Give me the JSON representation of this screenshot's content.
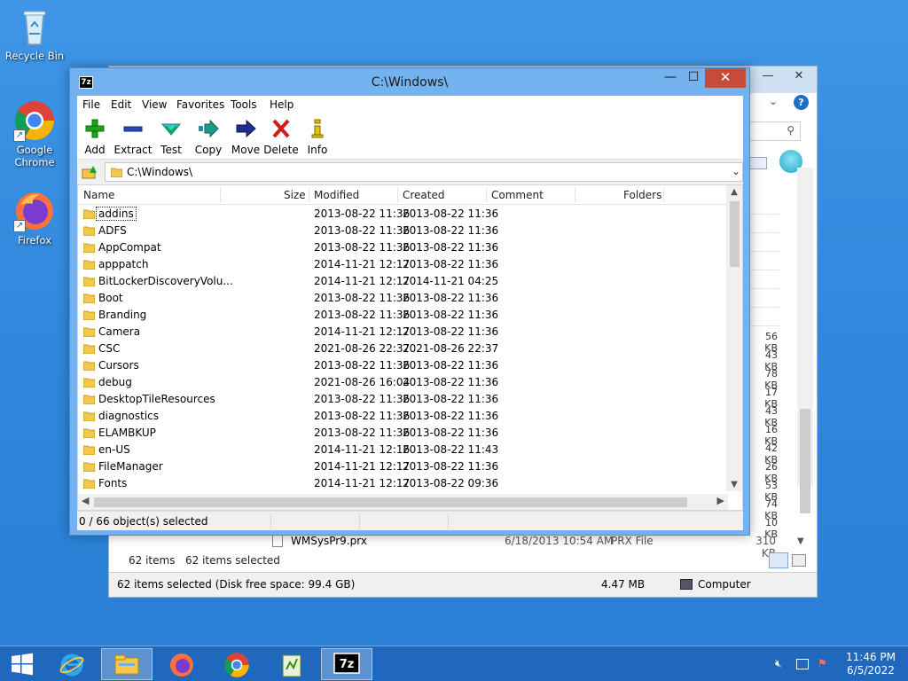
{
  "desktop": {
    "icons": [
      {
        "label": "Recycle Bin",
        "icon": "recycle-bin-icon"
      },
      {
        "label": "Google Chrome",
        "icon": "chrome-icon"
      },
      {
        "label": "Firefox",
        "icon": "firefox-icon"
      }
    ]
  },
  "background_window": {
    "sizes": [
      "56 KB",
      "43 KB",
      "78 KB",
      "17 KB",
      "43 KB",
      "16 KB",
      "42 KB",
      "26 KB",
      "53 KB",
      "74 KB",
      "10 KB"
    ],
    "last_row": {
      "name": "WMSysPr9.prx",
      "date": "6/18/2013 10:54 AM",
      "type": "PRX File",
      "size": "310 KB"
    },
    "items_count": "62 items",
    "items_selected": "62 items selected",
    "status_left": "62 items selected (Disk free space: 99.4 GB)",
    "status_size": "4.47 MB",
    "status_location": "Computer"
  },
  "sevenzip": {
    "title": "C:\\Windows\\",
    "app_icon_label": "7z",
    "menu": [
      "File",
      "Edit",
      "View",
      "Favorites",
      "Tools",
      "Help"
    ],
    "toolbar": [
      {
        "label": "Add",
        "icon": "add-icon"
      },
      {
        "label": "Extract",
        "icon": "extract-icon"
      },
      {
        "label": "Test",
        "icon": "test-icon"
      },
      {
        "label": "Copy",
        "icon": "copy-icon"
      },
      {
        "label": "Move",
        "icon": "move-icon"
      },
      {
        "label": "Delete",
        "icon": "delete-icon"
      },
      {
        "label": "Info",
        "icon": "info-icon"
      }
    ],
    "address": "C:\\Windows\\",
    "columns": {
      "name": "Name",
      "size": "Size",
      "modified": "Modified",
      "created": "Created",
      "comment": "Comment",
      "folders": "Folders"
    },
    "rows": [
      {
        "name": "addins",
        "modified": "2013-08-22 11:36",
        "created": "2013-08-22 11:36"
      },
      {
        "name": "ADFS",
        "modified": "2013-08-22 11:36",
        "created": "2013-08-22 11:36"
      },
      {
        "name": "AppCompat",
        "modified": "2013-08-22 11:36",
        "created": "2013-08-22 11:36"
      },
      {
        "name": "apppatch",
        "modified": "2014-11-21 12:17",
        "created": "2013-08-22 11:36"
      },
      {
        "name": "BitLockerDiscoveryVolu...",
        "modified": "2014-11-21 12:17",
        "created": "2014-11-21 04:25"
      },
      {
        "name": "Boot",
        "modified": "2013-08-22 11:36",
        "created": "2013-08-22 11:36"
      },
      {
        "name": "Branding",
        "modified": "2013-08-22 11:36",
        "created": "2013-08-22 11:36"
      },
      {
        "name": "Camera",
        "modified": "2014-11-21 12:17",
        "created": "2013-08-22 11:36"
      },
      {
        "name": "CSC",
        "modified": "2021-08-26 22:37",
        "created": "2021-08-26 22:37"
      },
      {
        "name": "Cursors",
        "modified": "2013-08-22 11:36",
        "created": "2013-08-22 11:36"
      },
      {
        "name": "debug",
        "modified": "2021-08-26 16:04",
        "created": "2013-08-22 11:36"
      },
      {
        "name": "DesktopTileResources",
        "modified": "2013-08-22 11:36",
        "created": "2013-08-22 11:36"
      },
      {
        "name": "diagnostics",
        "modified": "2013-08-22 11:36",
        "created": "2013-08-22 11:36"
      },
      {
        "name": "ELAMBKUP",
        "modified": "2013-08-22 11:36",
        "created": "2013-08-22 11:36"
      },
      {
        "name": "en-US",
        "modified": "2014-11-21 12:16",
        "created": "2013-08-22 11:43"
      },
      {
        "name": "FileManager",
        "modified": "2014-11-21 12:17",
        "created": "2013-08-22 11:36"
      },
      {
        "name": "Fonts",
        "modified": "2014-11-21 12:17",
        "created": "2013-08-22 09:36"
      }
    ],
    "status": "0 / 66 object(s) selected"
  },
  "taskbar": {
    "clock_time": "11:46 PM",
    "clock_date": "6/5/2022",
    "active_app": "7-Zip"
  },
  "colors": {
    "desktop_blue": "#2f86db",
    "titlebar_blue": "#74b2ef",
    "close_red": "#c74b3b",
    "folder_yellow": "#f4c84b"
  }
}
